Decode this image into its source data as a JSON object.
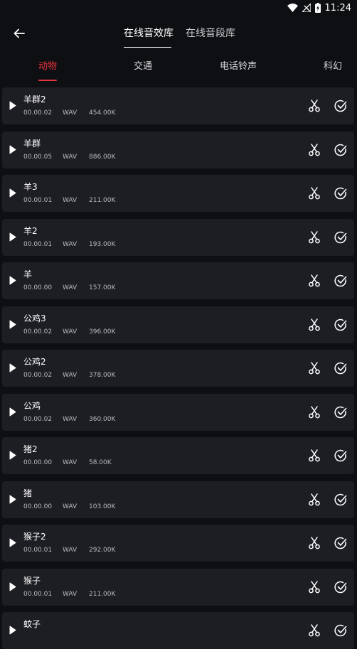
{
  "status": {
    "time": "11:24"
  },
  "header": {
    "tabs": [
      {
        "label": "在线音效库",
        "active": true
      },
      {
        "label": "在线音段库",
        "active": false
      }
    ]
  },
  "categories": [
    "动物",
    "交通",
    "电话铃声",
    "科幻"
  ],
  "active_category": "动物",
  "sounds": [
    {
      "title": "羊群2",
      "duration": "00.00.02",
      "format": "WAV",
      "size": "454.00K"
    },
    {
      "title": "羊群",
      "duration": "00.00.05",
      "format": "WAV",
      "size": "886.00K"
    },
    {
      "title": "羊3",
      "duration": "00.00.01",
      "format": "WAV",
      "size": "211.00K"
    },
    {
      "title": "羊2",
      "duration": "00.00.01",
      "format": "WAV",
      "size": "193.00K"
    },
    {
      "title": "羊",
      "duration": "00.00.00",
      "format": "WAV",
      "size": "157.00K"
    },
    {
      "title": "公鸡3",
      "duration": "00.00.02",
      "format": "WAV",
      "size": "396.00K"
    },
    {
      "title": "公鸡2",
      "duration": "00.00.02",
      "format": "WAV",
      "size": "378.00K"
    },
    {
      "title": "公鸡",
      "duration": "00.00.02",
      "format": "WAV",
      "size": "360.00K"
    },
    {
      "title": "猪2",
      "duration": "00.00.00",
      "format": "WAV",
      "size": "58.00K"
    },
    {
      "title": "猪",
      "duration": "00.00.00",
      "format": "WAV",
      "size": "103.00K"
    },
    {
      "title": "猴子2",
      "duration": "00.00.01",
      "format": "WAV",
      "size": "292.00K"
    },
    {
      "title": "猴子",
      "duration": "00.00.01",
      "format": "WAV",
      "size": "211.00K"
    },
    {
      "title": "蚊子",
      "duration": "",
      "format": "",
      "size": ""
    }
  ],
  "icons": {
    "back": "arrow-left-icon",
    "play": "play-icon",
    "cut": "scissors-icon",
    "select": "check-circle-icon"
  },
  "colors": {
    "background": "#0e0f13",
    "card": "#1d1e24",
    "accent": "#e5333a"
  }
}
